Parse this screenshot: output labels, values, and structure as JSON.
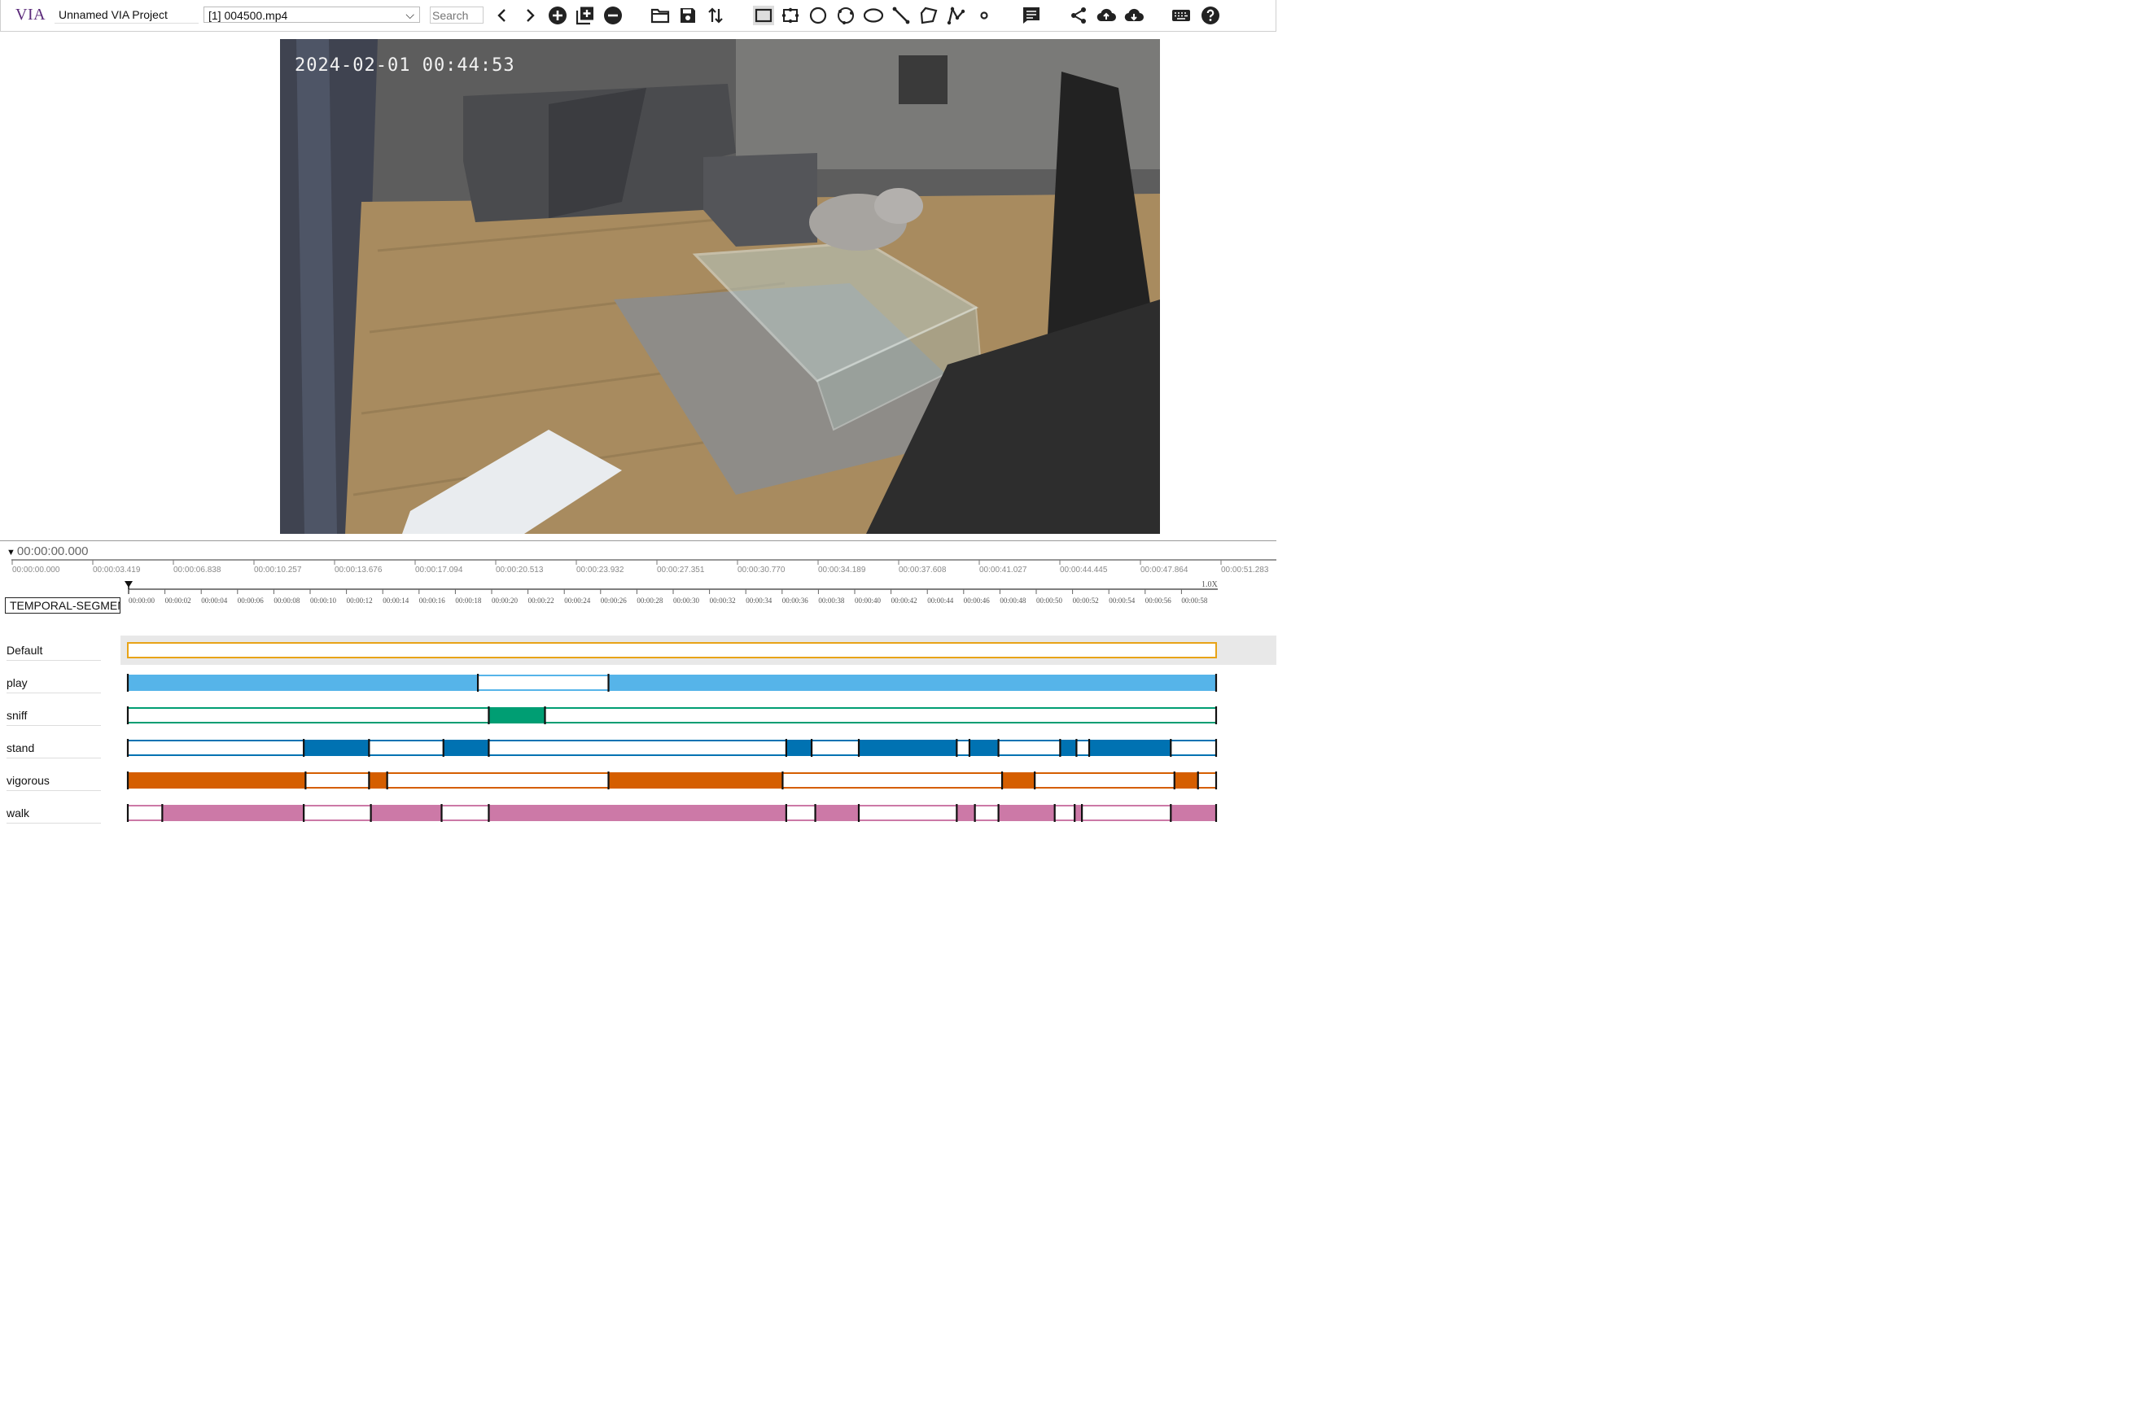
{
  "app": {
    "logo": "VIA",
    "project_name": "Unnamed VIA Project"
  },
  "file": {
    "selected": "[1] 004500.mp4"
  },
  "search": {
    "placeholder": "Search"
  },
  "toolbar": {
    "icons": [
      "prev-file-icon",
      "next-file-icon",
      "add-file-icon",
      "add-multiple-files-icon",
      "remove-file-icon",
      "open-project-icon",
      "save-project-icon",
      "sort-icon",
      "rect-shape-icon",
      "extreme-rect-shape-icon",
      "circle-shape-icon",
      "extreme-circle-shape-icon",
      "ellipse-shape-icon",
      "line-shape-icon",
      "polygon-shape-icon",
      "polyline-shape-icon",
      "point-shape-icon",
      "annotation-editor-icon",
      "share-icon",
      "upload-icon",
      "download-icon",
      "keyboard-shortcuts-icon",
      "help-icon"
    ]
  },
  "video": {
    "timestamp": "2024-02-01  00:44:53"
  },
  "timeline": {
    "current_time": "00:00:00.000",
    "playback_rate": "1.0X",
    "group": "TEMPORAL-SEGMENTS",
    "duration_sec": 60,
    "overview_ticks": [
      "00:00:00.000",
      "00:00:03.419",
      "00:00:06.838",
      "00:00:10.257",
      "00:00:13.676",
      "00:00:17.094",
      "00:00:20.513",
      "00:00:23.932",
      "00:00:27.351",
      "00:00:30.770",
      "00:00:34.189",
      "00:00:37.608",
      "00:00:41.027",
      "00:00:44.445",
      "00:00:47.864",
      "00:00:51.283"
    ],
    "detail_ticks": [
      "00:00:00",
      "00:00:02",
      "00:00:04",
      "00:00:06",
      "00:00:08",
      "00:00:10",
      "00:00:12",
      "00:00:14",
      "00:00:16",
      "00:00:18",
      "00:00:20",
      "00:00:22",
      "00:00:24",
      "00:00:26",
      "00:00:28",
      "00:00:30",
      "00:00:32",
      "00:00:34",
      "00:00:36",
      "00:00:38",
      "00:00:40",
      "00:00:42",
      "00:00:44",
      "00:00:46",
      "00:00:48",
      "00:00:50",
      "00:00:52",
      "00:00:54",
      "00:00:56",
      "00:00:58"
    ],
    "tracks": [
      {
        "name": "Default",
        "color": "#e8a317",
        "segments": []
      },
      {
        "name": "play",
        "color": "#56b4e9",
        "segments": [
          [
            0,
            19.3
          ],
          [
            26.5,
            60
          ]
        ]
      },
      {
        "name": "sniff",
        "color": "#009e73",
        "segments": [
          [
            19.9,
            23.0
          ]
        ]
      },
      {
        "name": "stand",
        "color": "#0072b2",
        "segments": [
          [
            9.7,
            13.3
          ],
          [
            17.4,
            19.9
          ],
          [
            36.3,
            37.7
          ],
          [
            40.3,
            45.7
          ],
          [
            46.4,
            48.0
          ],
          [
            51.4,
            52.3
          ],
          [
            53.0,
            57.5
          ]
        ]
      },
      {
        "name": "vigorous",
        "color": "#d55e00",
        "segments": [
          [
            0,
            9.8
          ],
          [
            13.3,
            14.3
          ],
          [
            26.5,
            36.1
          ],
          [
            48.2,
            50.0
          ],
          [
            57.7,
            59.0
          ]
        ]
      },
      {
        "name": "walk",
        "color": "#cc79a7",
        "segments": [
          [
            1.9,
            9.7
          ],
          [
            13.4,
            17.3
          ],
          [
            19.9,
            36.3
          ],
          [
            37.9,
            40.3
          ],
          [
            45.7,
            46.7
          ],
          [
            48.0,
            51.1
          ],
          [
            52.2,
            52.6
          ],
          [
            57.5,
            60
          ]
        ]
      }
    ]
  }
}
